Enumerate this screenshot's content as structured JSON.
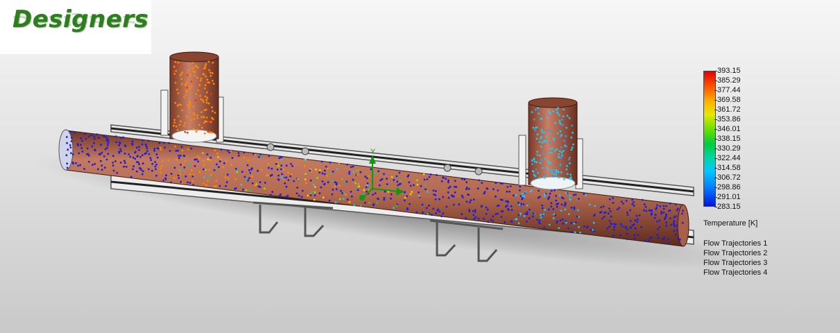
{
  "logo": {
    "text": "Designers"
  },
  "legend": {
    "ticks": [
      "393.15",
      "385.29",
      "377.44",
      "369.58",
      "361.72",
      "353.86",
      "346.01",
      "338.15",
      "330.29",
      "322.44",
      "314.58",
      "306.72",
      "298.86",
      "291.01",
      "283.15"
    ],
    "title": "Temperature [K]",
    "trajectories": [
      "Flow Trajectories 1",
      "Flow Trajectories 2",
      "Flow Trajectories 3",
      "Flow Trajectories 4"
    ],
    "colors": [
      "#e50000",
      "#ff5a00",
      "#ffb000",
      "#e4e800",
      "#5ee000",
      "#00cc40",
      "#00d6a0",
      "#00c8ff",
      "#0080ff",
      "#0014e0"
    ]
  },
  "axis_triad": {
    "y_label": "Y"
  },
  "colors": {
    "pipe": "#b86b52",
    "pipe_dark": "#7a3b2a",
    "hot_particles": "#ff8800",
    "cold_particles": "#1c1ce0"
  }
}
